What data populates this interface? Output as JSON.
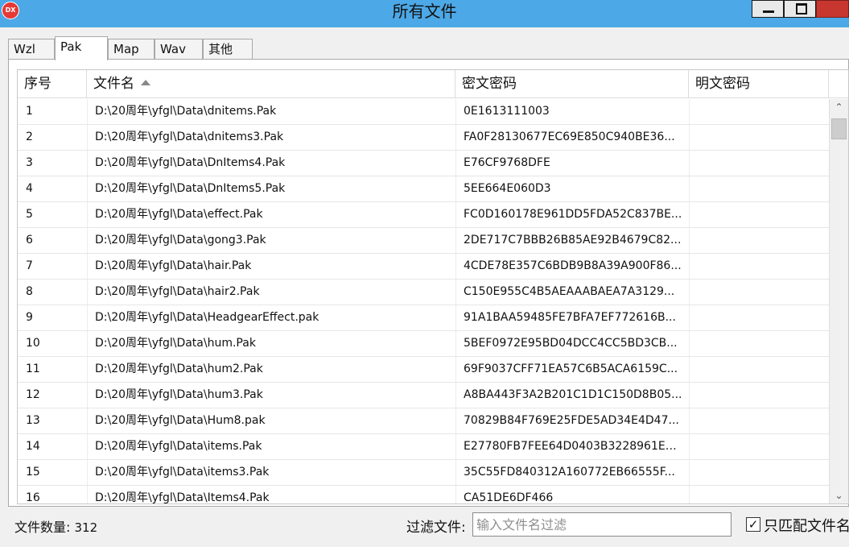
{
  "window": {
    "title": "所有文件",
    "app_icon_text": "DX",
    "minimize_icon": "minimize-icon",
    "maximize_icon": "maximize-icon"
  },
  "tabs": [
    {
      "label": "Wzl",
      "active": false
    },
    {
      "label": "Pak",
      "active": true
    },
    {
      "label": "Map",
      "active": false
    },
    {
      "label": "Wav",
      "active": false
    },
    {
      "label": "其他",
      "active": false
    }
  ],
  "table": {
    "columns": [
      "序号",
      "文件名",
      "密文密码",
      "明文密码"
    ],
    "sort_column": "文件名",
    "sort_direction": "ascending",
    "rows": [
      {
        "index": "1",
        "filename": "D:\\20周年\\yfgl\\Data\\dnitems.Pak",
        "cipher": "0E1613111003",
        "plain": ""
      },
      {
        "index": "2",
        "filename": "D:\\20周年\\yfgl\\Data\\dnitems3.Pak",
        "cipher": "FA0F28130677EC69E850C940BE36...",
        "plain": ""
      },
      {
        "index": "3",
        "filename": "D:\\20周年\\yfgl\\Data\\DnItems4.Pak",
        "cipher": "E76CF9768DFE",
        "plain": ""
      },
      {
        "index": "4",
        "filename": "D:\\20周年\\yfgl\\Data\\DnItems5.Pak",
        "cipher": "5EE664E060D3",
        "plain": ""
      },
      {
        "index": "5",
        "filename": "D:\\20周年\\yfgl\\Data\\effect.Pak",
        "cipher": "FC0D160178E961DD5FDA52C837BE...",
        "plain": ""
      },
      {
        "index": "6",
        "filename": "D:\\20周年\\yfgl\\Data\\gong3.Pak",
        "cipher": "2DE717C7BBB26B85AE92B4679C82...",
        "plain": ""
      },
      {
        "index": "7",
        "filename": "D:\\20周年\\yfgl\\Data\\hair.Pak",
        "cipher": "4CDE78E357C6BDB9B8A39A900F86...",
        "plain": ""
      },
      {
        "index": "8",
        "filename": "D:\\20周年\\yfgl\\Data\\hair2.Pak",
        "cipher": "C150E955C4B5AEAAABAEA7A3129...",
        "plain": ""
      },
      {
        "index": "9",
        "filename": "D:\\20周年\\yfgl\\Data\\HeadgearEffect.pak",
        "cipher": "91A1BAA59485FE7BFA7EF772616B...",
        "plain": ""
      },
      {
        "index": "10",
        "filename": "D:\\20周年\\yfgl\\Data\\hum.Pak",
        "cipher": "5BEF0972E95BD04DCC4CC5BD3CB...",
        "plain": ""
      },
      {
        "index": "11",
        "filename": "D:\\20周年\\yfgl\\Data\\hum2.Pak",
        "cipher": "69F9037CFF71EA57C6B5ACA6159C...",
        "plain": ""
      },
      {
        "index": "12",
        "filename": "D:\\20周年\\yfgl\\Data\\hum3.Pak",
        "cipher": "A8BA443F3A2B201C1D1C150D8B05...",
        "plain": ""
      },
      {
        "index": "13",
        "filename": "D:\\20周年\\yfgl\\Data\\Hum8.pak",
        "cipher": "70829B84F769E25FDE5AD34E4D47...",
        "plain": ""
      },
      {
        "index": "14",
        "filename": "D:\\20周年\\yfgl\\Data\\items.Pak",
        "cipher": "E27780FB7FEE64D0403B3228961E9...",
        "plain": ""
      },
      {
        "index": "15",
        "filename": "D:\\20周年\\yfgl\\Data\\items3.Pak",
        "cipher": "35C55FD840312A160772EB66555F...",
        "plain": ""
      },
      {
        "index": "16",
        "filename": "D:\\20周年\\yfgl\\Data\\Items4.Pak",
        "cipher": "CA51DE6DF466",
        "plain": ""
      }
    ]
  },
  "footer": {
    "count_label": "文件数量:",
    "count_value": "312",
    "filter_label": "过滤文件:",
    "filter_value": "",
    "filter_placeholder": "输入文件名过滤",
    "checkbox_label": "只匹配文件名",
    "checkbox_checked": true
  },
  "colors": {
    "titlebar": "#4ca8e6",
    "close_button": "#c7372f",
    "window_bg": "#f0f0f0"
  }
}
